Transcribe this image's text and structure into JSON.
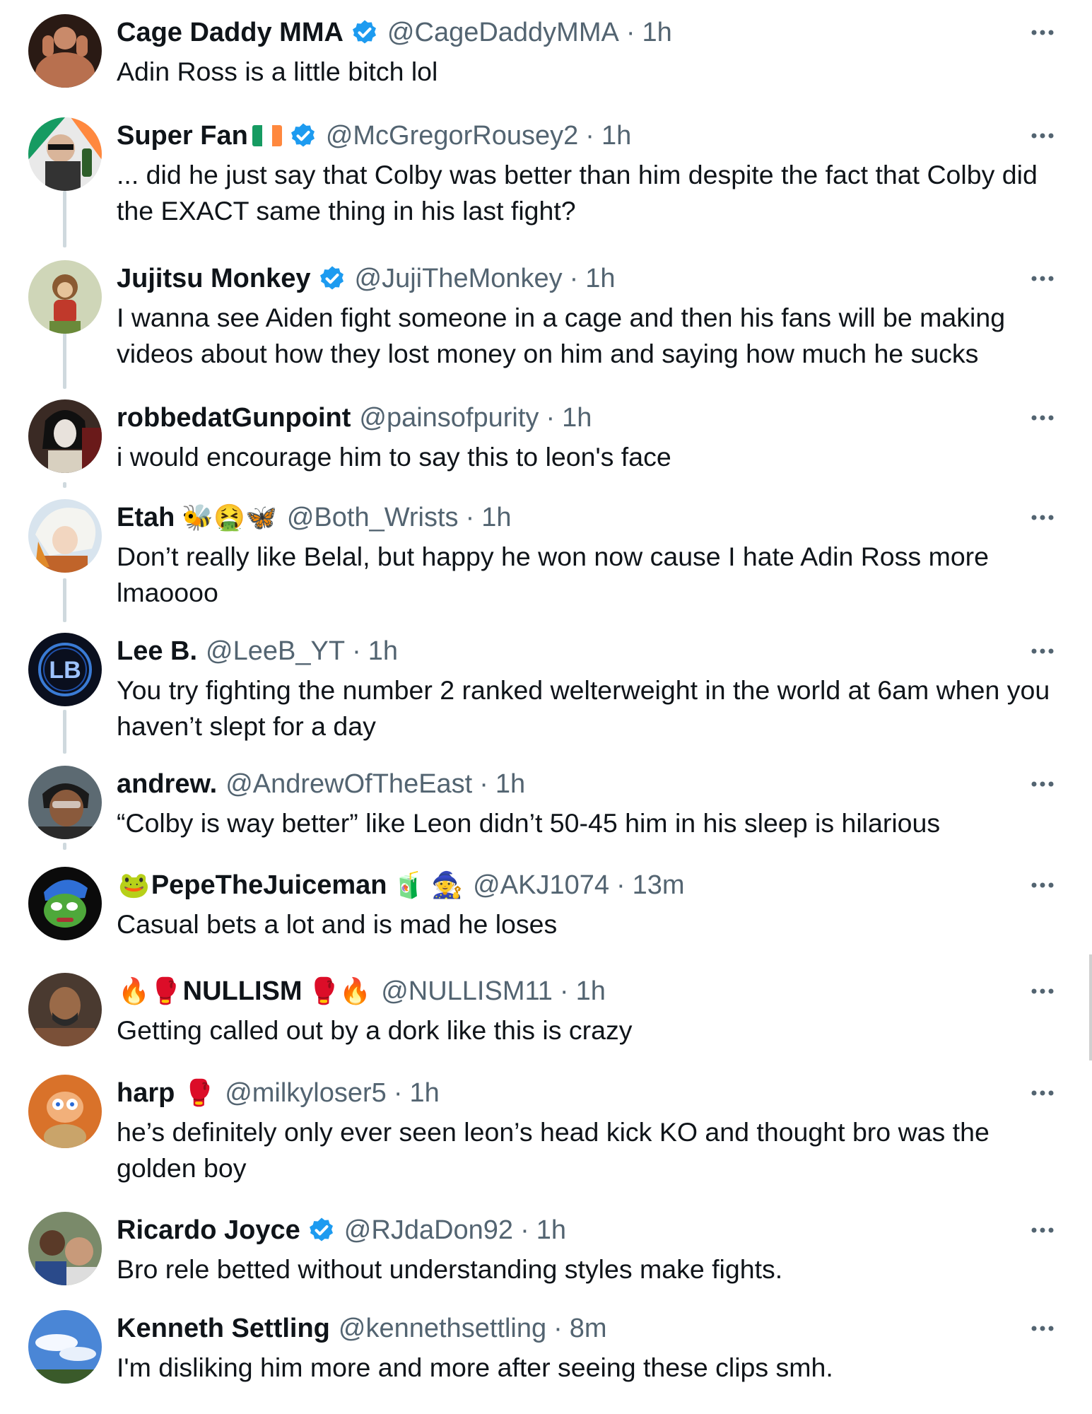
{
  "colors": {
    "text": "#0f1419",
    "muted": "#536471",
    "verified": "#1d9bf0",
    "thread": "#cfd9de"
  },
  "feed": {
    "replies": [
      {
        "name": "Cage Daddy MMA",
        "name_suffix": "",
        "verified": true,
        "handle": "@CageDaddyMMA",
        "time": "1h",
        "text": "Adin Ross is a little bitch lol"
      },
      {
        "name": "Super Fan",
        "name_suffix": "",
        "verified": true,
        "flag": "irish-flag",
        "handle": "@McGregorRousey2",
        "time": "1h",
        "text": "... did he just say that Colby was better than him despite the fact that Colby did the EXACT same thing in his last fight?"
      },
      {
        "name": "Jujitsu Monkey",
        "name_suffix": "",
        "verified": true,
        "handle": "@JujiTheMonkey",
        "time": "1h",
        "text": "I wanna see Aiden fight someone in a cage and then his fans will be making videos about how they lost money on him and saying how much he sucks"
      },
      {
        "name": "robbedatGunpoint",
        "name_suffix": "",
        "verified": false,
        "handle": "@painsofpurity",
        "time": "1h",
        "text": "i would encourage him to say this to leon's face"
      },
      {
        "name": "Etah",
        "name_suffix": "🐝🤮🦋",
        "verified": false,
        "handle": "@Both_Wrists",
        "time": "1h",
        "text": "Don’t really like Belal, but happy he won now cause I hate Adin Ross more lmaoooo"
      },
      {
        "name": "Lee B.",
        "name_suffix": "",
        "verified": false,
        "handle": "@LeeB_YT",
        "time": "1h",
        "text": "You try fighting the number 2 ranked welterweight in the world at 6am when you haven’t slept for a day"
      },
      {
        "name": "andrew.",
        "name_suffix": "",
        "verified": false,
        "handle": "@AndrewOfTheEast",
        "time": "1h",
        "text": "“Colby is way better” like Leon didn’t 50-45 him in his sleep is hilarious"
      },
      {
        "name": "PepeTheJuiceman",
        "name_prefix": "🐸",
        "name_suffix": "🧃 🧙",
        "verified": false,
        "handle": "@AKJ1074",
        "time": "13m",
        "text": "Casual bets a lot and is mad he loses"
      },
      {
        "name": "NULLISM",
        "name_prefix": "🔥🥊",
        "name_suffix": "🥊🔥",
        "verified": false,
        "handle": "@NULLISM11",
        "time": "1h",
        "text": "Getting called out by a dork like this is crazy"
      },
      {
        "name": "harp",
        "name_suffix": "🥊",
        "verified": false,
        "handle": "@milkyloser5",
        "time": "1h",
        "text": "he’s definitely only ever seen leon’s head kick KO and thought bro was the golden boy"
      },
      {
        "name": "Ricardo Joyce",
        "name_suffix": "",
        "verified": true,
        "handle": "@RJdaDon92",
        "time": "1h",
        "text": "Bro rele betted without understanding styles make fights."
      },
      {
        "name": "Kenneth Settling",
        "name_suffix": "",
        "verified": false,
        "handle": "@kennethsettling",
        "time": "8m",
        "text": "I'm disliking him more and more after seeing these clips smh."
      }
    ],
    "separator": "·",
    "avatar_icons": [
      "avatar-bodybuilder",
      "avatar-sunglasses-man",
      "avatar-monkey",
      "avatar-goth-portrait",
      "avatar-anime-character",
      "avatar-lb-logo",
      "avatar-man-glasses",
      "avatar-pepe-frog",
      "avatar-fighter",
      "avatar-cartoon",
      "avatar-group-selfie",
      "avatar-sky"
    ],
    "more_icon": "more-horizontal-icon"
  }
}
